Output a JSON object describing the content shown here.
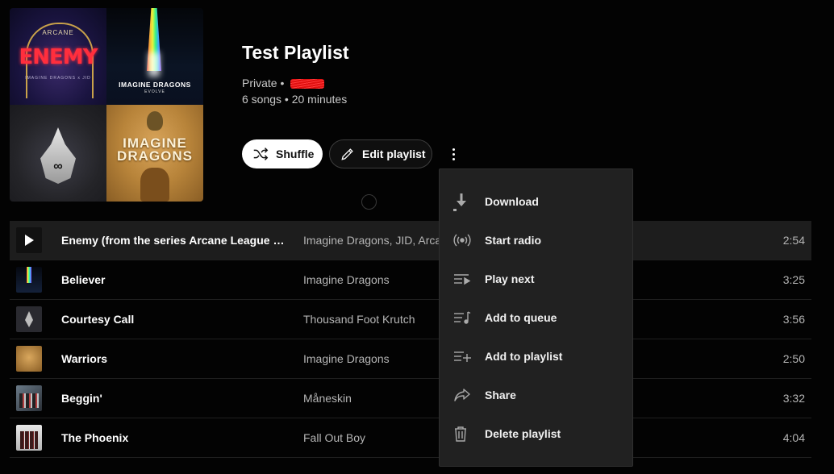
{
  "collage": {
    "tile1": {
      "small": "ARCANE",
      "big": "ENEMY",
      "tiny": "IMAGINE DRAGONS x JID"
    },
    "tile2": {
      "title": "IMAGINE DRAGONS",
      "sub": "EVOLVE"
    },
    "tile4": {
      "title": "IMAGINE DRAGONS",
      "sub": ""
    }
  },
  "playlist": {
    "title": "Test Playlist",
    "privacy": "Private",
    "separator": " • ",
    "stats": "6 songs • 20 minutes"
  },
  "actions": {
    "shuffle_label": "Shuffle",
    "edit_label": "Edit playlist"
  },
  "tracks": [
    {
      "title": "Enemy (from the series Arcane League of Legends)",
      "artist": "Imagine Dragons, JID, Arcane",
      "duration": "2:54"
    },
    {
      "title": "Believer",
      "artist": "Imagine Dragons",
      "duration": "3:25"
    },
    {
      "title": "Courtesy Call",
      "artist": "Thousand Foot Krutch",
      "duration": "3:56"
    },
    {
      "title": "Warriors",
      "artist": "Imagine Dragons",
      "duration": "2:50"
    },
    {
      "title": "Beggin'",
      "artist": "Måneskin",
      "duration": "3:32"
    },
    {
      "title": "The Phoenix",
      "artist": "Fall Out Boy",
      "duration": "4:04"
    }
  ],
  "menu": {
    "items": [
      {
        "label": "Download",
        "icon": "download-icon"
      },
      {
        "label": "Start radio",
        "icon": "radio-icon"
      },
      {
        "label": "Play next",
        "icon": "play-next-icon"
      },
      {
        "label": "Add to queue",
        "icon": "add-to-queue-icon"
      },
      {
        "label": "Add to playlist",
        "icon": "add-to-playlist-icon"
      },
      {
        "label": "Share",
        "icon": "share-icon"
      },
      {
        "label": "Delete playlist",
        "icon": "trash-icon"
      }
    ]
  },
  "colors": {
    "background": "#030303",
    "menu_bg": "#212121",
    "active_row": "#1d1d1d",
    "secondary_text": "#b5b5b5"
  }
}
